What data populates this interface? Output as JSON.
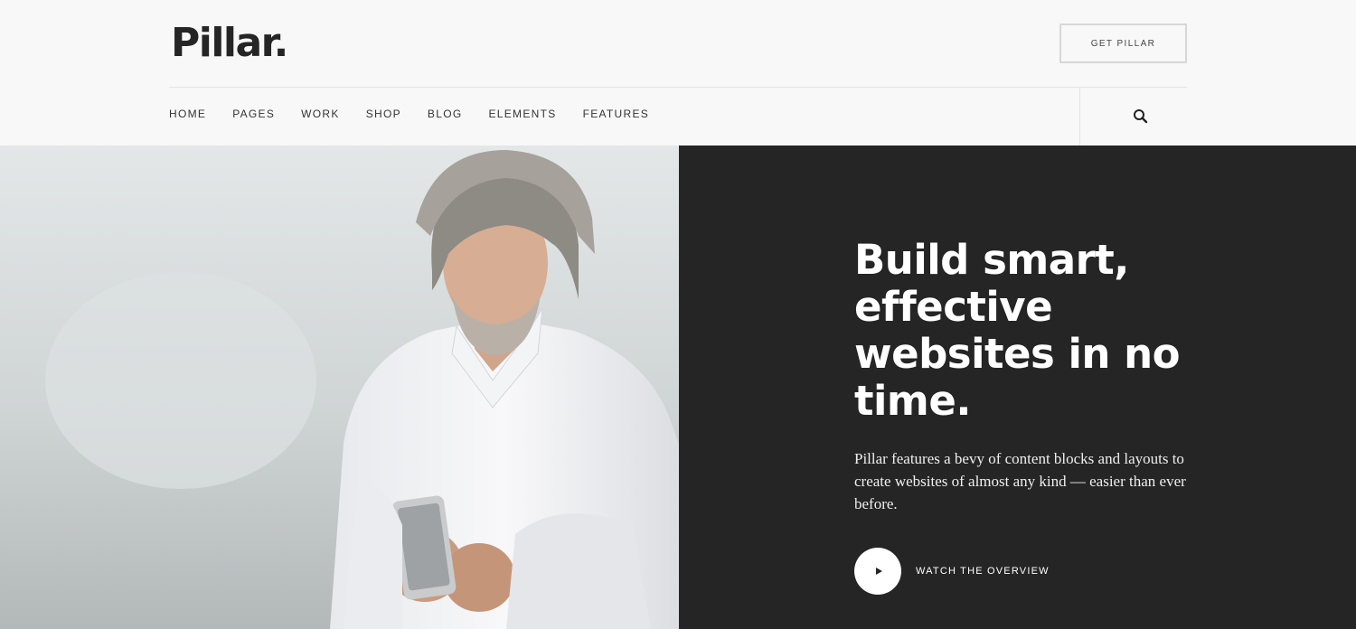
{
  "header": {
    "logo": "Pillar.",
    "cta_label": "GET PILLAR",
    "nav": [
      "HOME",
      "PAGES",
      "WORK",
      "SHOP",
      "BLOG",
      "ELEMENTS",
      "FEATURES"
    ],
    "search_icon": "search-icon"
  },
  "hero": {
    "headline": "Build smart, effective websites in no time.",
    "lede": "Pillar features a bevy of content blocks and layouts to create websites of almost any kind — easier than ever before.",
    "watch_label": "WATCH THE OVERVIEW",
    "play_icon": "play-icon",
    "panel_color": "#252525"
  }
}
